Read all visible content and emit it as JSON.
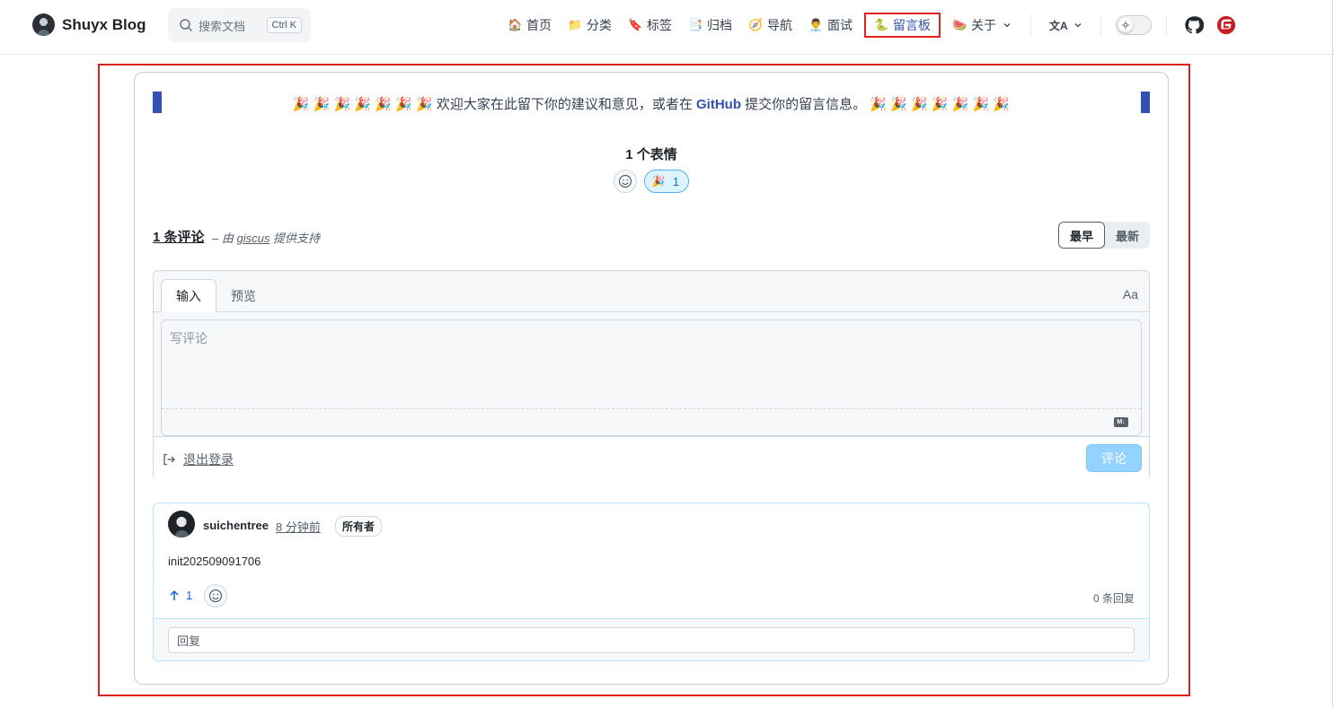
{
  "brand": {
    "title": "Shuyx Blog"
  },
  "search": {
    "placeholder": "搜索文档",
    "shortcut": "Ctrl K"
  },
  "nav": {
    "items": [
      {
        "emoji": "🏠",
        "label": "首页"
      },
      {
        "emoji": "📁",
        "label": "分类"
      },
      {
        "emoji": "🔖",
        "label": "标签"
      },
      {
        "emoji": "📑",
        "label": "归档"
      },
      {
        "emoji": "🧭",
        "label": "导航"
      },
      {
        "emoji": "👨‍💼",
        "label": "面试"
      },
      {
        "emoji": "🐍",
        "label": "留言板",
        "active": true
      },
      {
        "emoji": "🍉",
        "label": "关于"
      }
    ],
    "translate_glyph": "文A"
  },
  "banner": {
    "emoji_row": "🎉 🎉 🎉 🎉 🎉 🎉 🎉",
    "text_before": "欢迎大家在此留下你的建议和意见，或者在",
    "link": "GitHub",
    "text_after": "提交你的留言信息。"
  },
  "reactions": {
    "title": "1 个表情",
    "emoji": "🎉",
    "count": "1"
  },
  "comments": {
    "count_label": "1 条评论",
    "powered_prefix": "– 由",
    "powered_link": "giscus",
    "powered_suffix": "提供支持",
    "sort": [
      "最早",
      "最新"
    ]
  },
  "editor": {
    "tabs": [
      "输入",
      "预览"
    ],
    "format_label": "Aa",
    "placeholder": "写评论",
    "md_label": "M↓",
    "logout_label": "退出登录",
    "submit_label": "评论"
  },
  "comment": {
    "author": "suichentree",
    "time": "8 分钟前",
    "badge": "所有者",
    "body": "init202509091706",
    "upvotes": "1",
    "replies": "0 条回复",
    "reply_placeholder": "回复"
  },
  "colors": {
    "accent": "#3451b2",
    "highlight": "#e0201a",
    "link": "#0969da"
  }
}
